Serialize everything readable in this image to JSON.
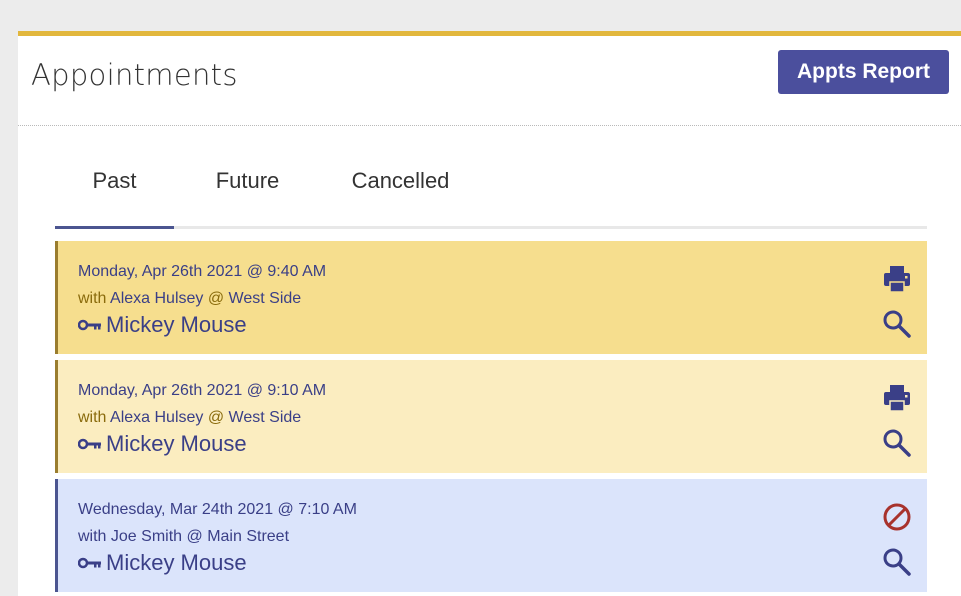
{
  "header": {
    "title": "Appointments",
    "report_button_label": "Appts Report"
  },
  "tabs": [
    {
      "label": "Past",
      "active": true
    },
    {
      "label": "Future",
      "active": false
    },
    {
      "label": "Cancelled",
      "active": false
    }
  ],
  "appointments": [
    {
      "datetime": "Monday, Apr 26th 2021 @ 9:40 AM",
      "with_prefix": "with",
      "provider": "Alexa Hulsey",
      "at": "@",
      "location": "West Side",
      "patient": "Mickey Mouse",
      "status_icon": "print-icon",
      "background": "#f6de8e"
    },
    {
      "datetime": "Monday, Apr 26th 2021 @ 9:10 AM",
      "with_prefix": "with",
      "provider": "Alexa Hulsey",
      "at": "@",
      "location": "West Side",
      "patient": "Mickey Mouse",
      "status_icon": "print-icon",
      "background": "#fbedc0"
    },
    {
      "datetime": "Wednesday, Mar 24th 2021 @ 7:10 AM",
      "with_prefix": "with",
      "provider": "Joe Smith",
      "at": "@",
      "location": "Main Street",
      "patient": "Mickey Mouse",
      "status_icon": "cancelled-icon",
      "background": "#dbe4fb"
    }
  ],
  "colors": {
    "accent_gold": "#e2b73d",
    "primary": "#4b4f9d",
    "text_blue": "#3a3f87",
    "cancel_red": "#a8322c"
  }
}
